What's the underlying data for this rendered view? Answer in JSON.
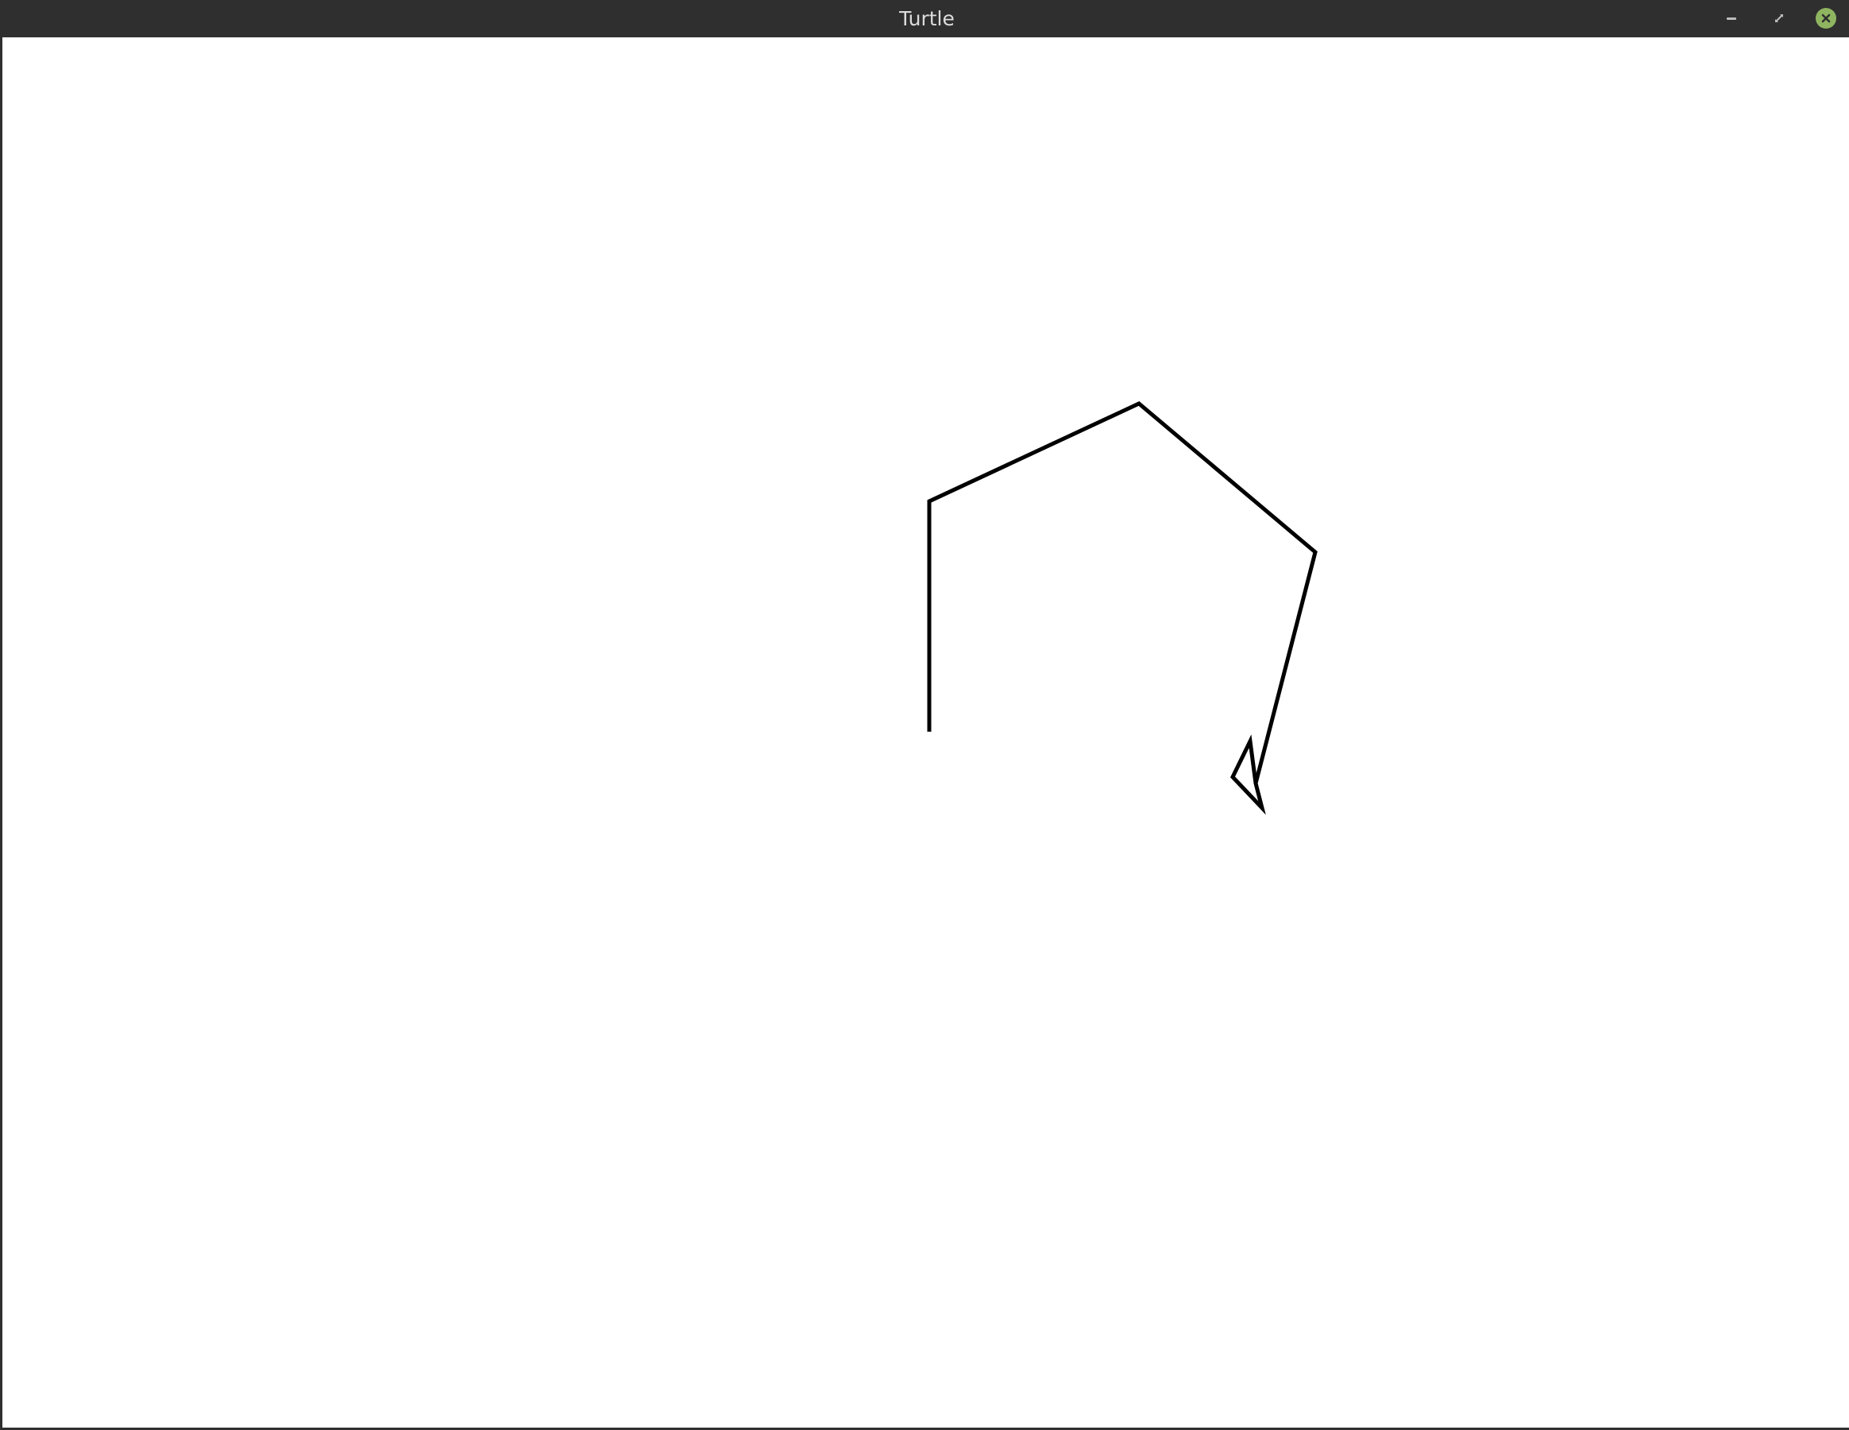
{
  "window": {
    "title": "Turtle"
  },
  "titlebar_controls": {
    "minimize_icon": "minimize-icon",
    "maximize_icon": "maximize-icon",
    "close_icon": "close-icon",
    "close_color": "#8fb560"
  },
  "canvas": {
    "background": "#ffffff",
    "pen_color": "#000000",
    "turtle_shape": "arrow"
  }
}
